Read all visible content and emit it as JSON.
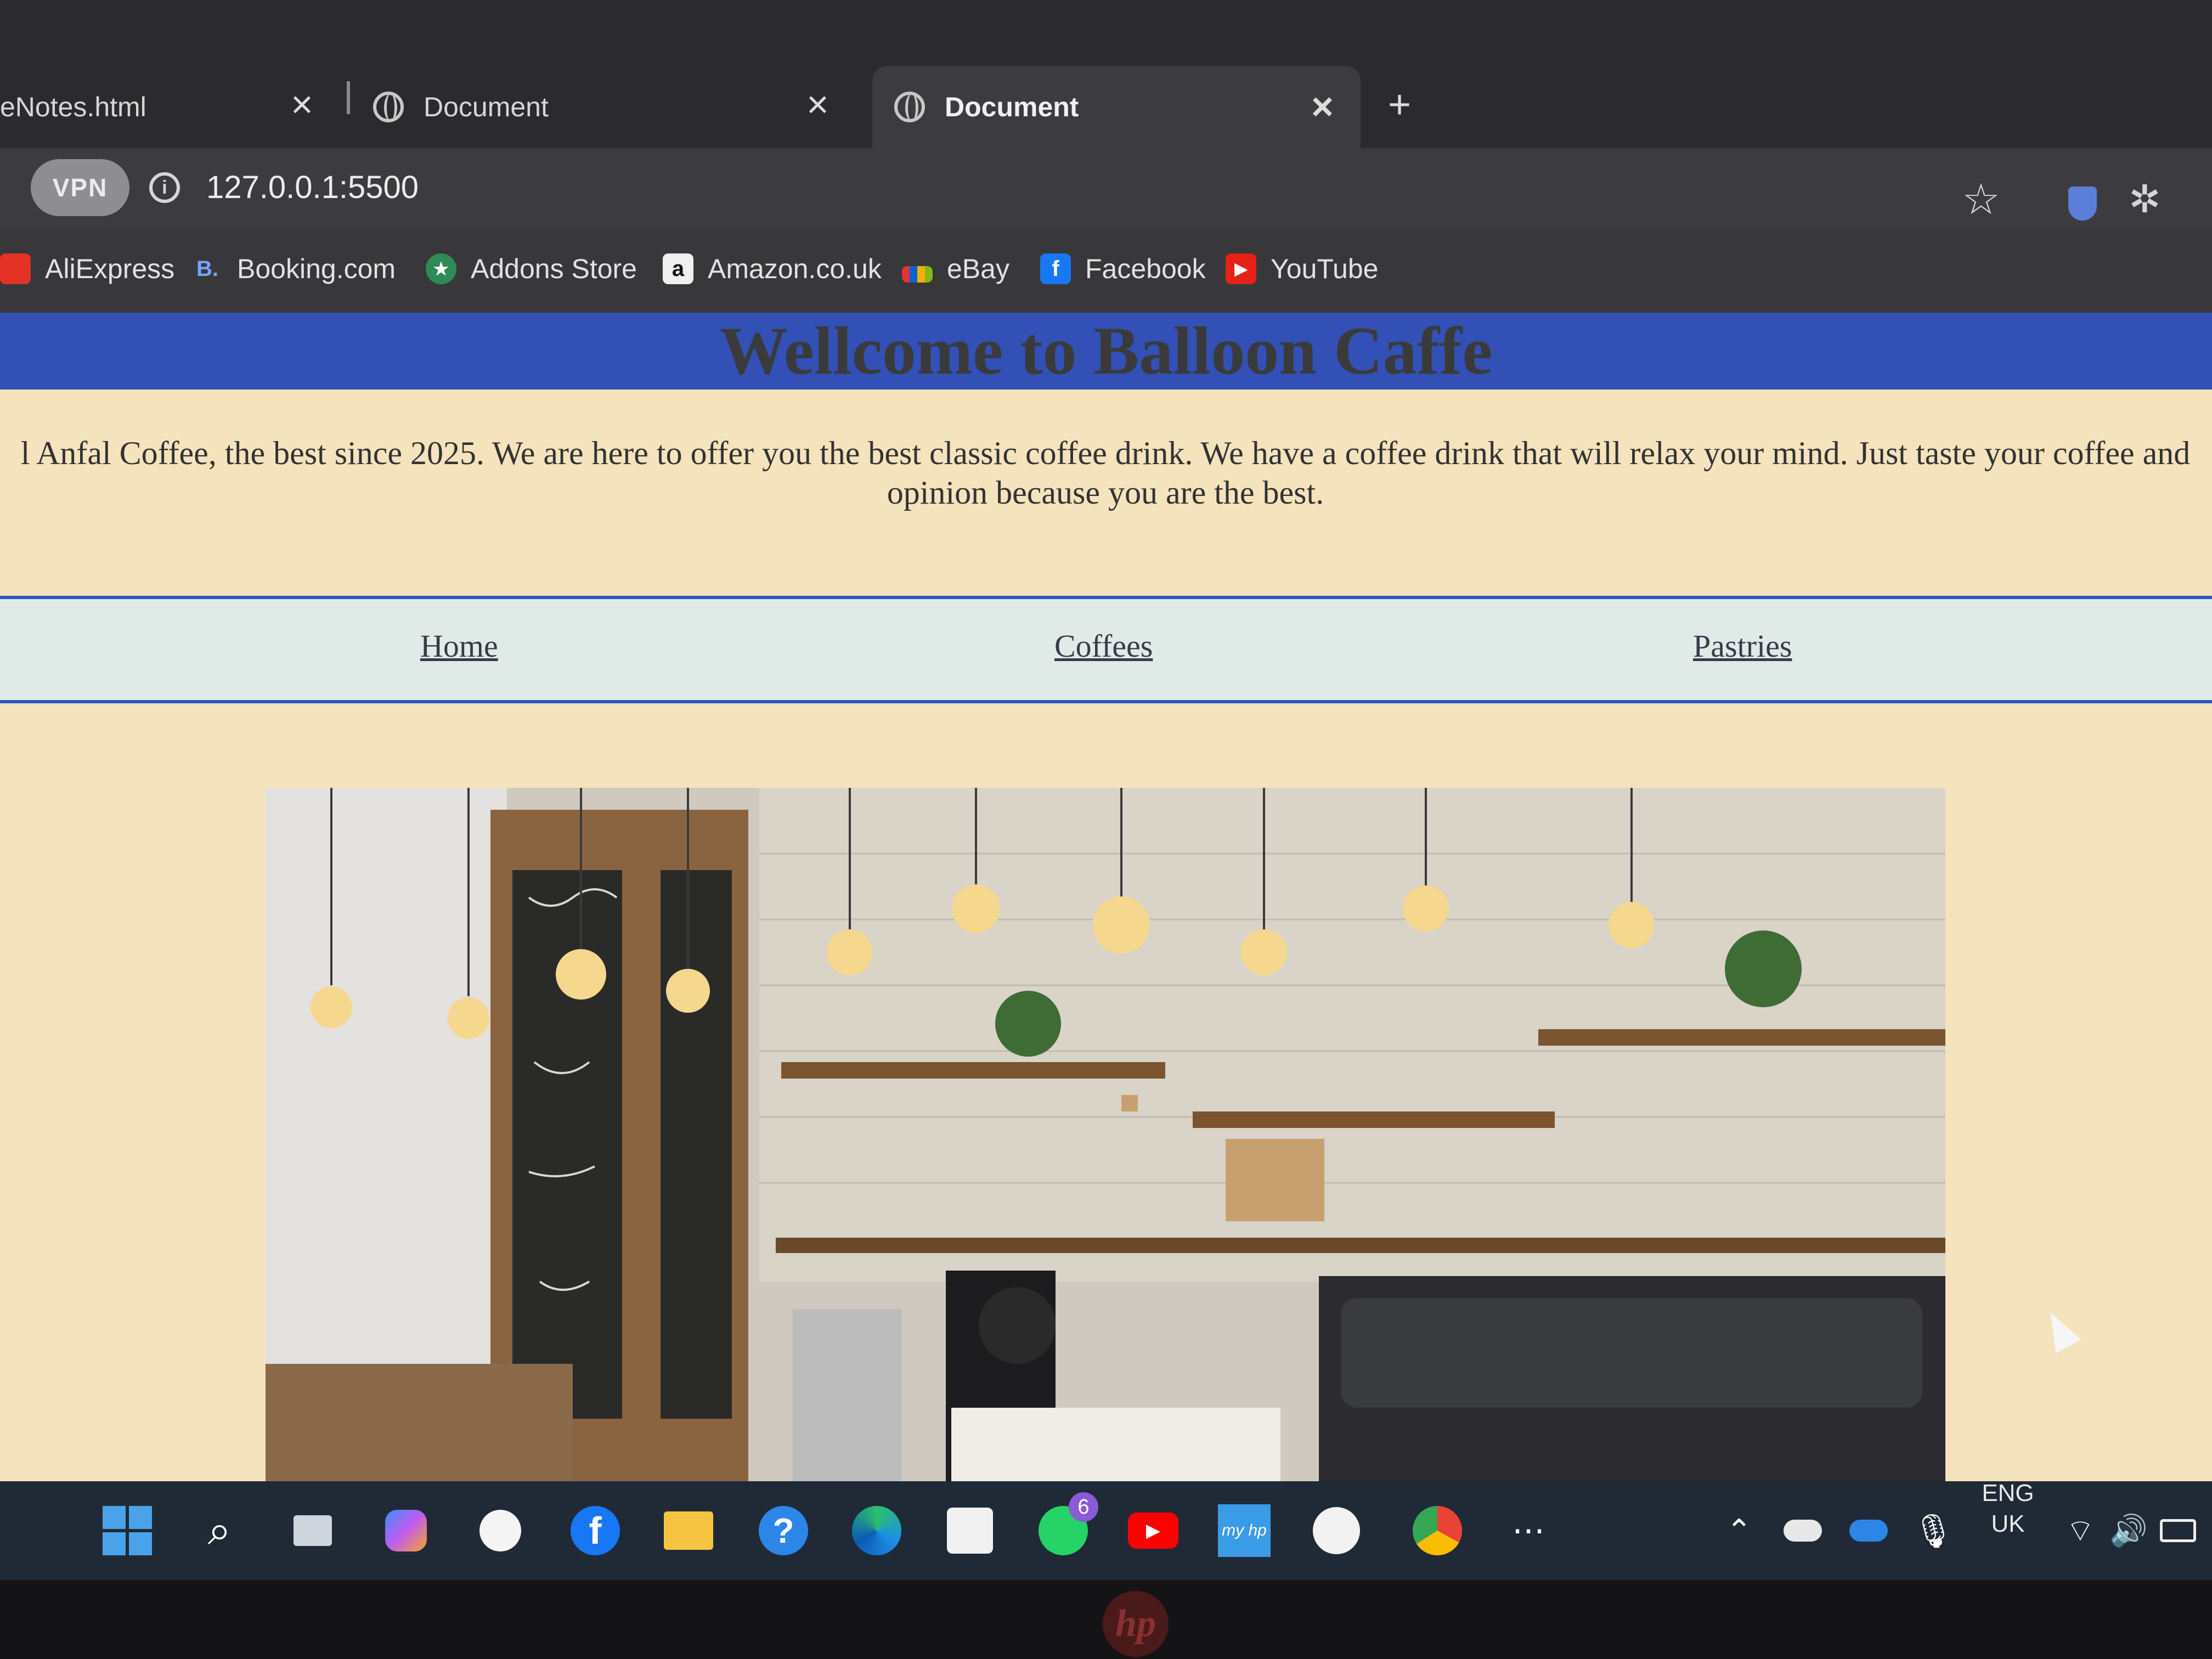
{
  "browser": {
    "tabs": [
      {
        "title": "eNotes.html",
        "active": false
      },
      {
        "title": "Document",
        "active": false
      },
      {
        "title": "Document",
        "active": true
      }
    ],
    "vpn_label": "VPN",
    "url": "127.0.0.1:5500",
    "bookmarks": [
      {
        "label": "AliExpress",
        "icon": "aliexpress-icon",
        "color": "#e43225"
      },
      {
        "label": "Booking.com",
        "icon": "booking-icon",
        "glyph": "B.",
        "color": "#2a4aa8"
      },
      {
        "label": "Addons Store",
        "icon": "addons-store-icon",
        "glyph": "★",
        "color": "#2e8b57"
      },
      {
        "label": "Amazon.co.uk",
        "icon": "amazon-icon",
        "glyph": "a",
        "color": "#f0f0f0"
      },
      {
        "label": "eBay",
        "icon": "ebay-icon",
        "color": "#e53238"
      },
      {
        "label": "Facebook",
        "icon": "facebook-icon",
        "glyph": "f",
        "color": "#1877f2"
      },
      {
        "label": "YouTube",
        "icon": "youtube-icon",
        "glyph": "▶",
        "color": "#e62117"
      }
    ]
  },
  "page": {
    "title": "Wellcome to Balloon Caffe",
    "intro_line1": "l Anfal Coffee, the best since 2025. We are here to offer you the best classic coffee drink. We have a coffee drink that will relax your mind. Just taste your coffee and",
    "intro_line2": "opinion because you are the best.",
    "nav": [
      "Home",
      "Coffees",
      "Pastries"
    ],
    "colors": {
      "header": "#3250b5",
      "background": "#f5e3bd",
      "nav_bg": "#e0ebe8",
      "nav_border": "#2c55c8"
    }
  },
  "taskbar": {
    "whatsapp_badge": "6",
    "language_line1": "ENG",
    "language_line2": "UK"
  },
  "device_logo": "hp"
}
